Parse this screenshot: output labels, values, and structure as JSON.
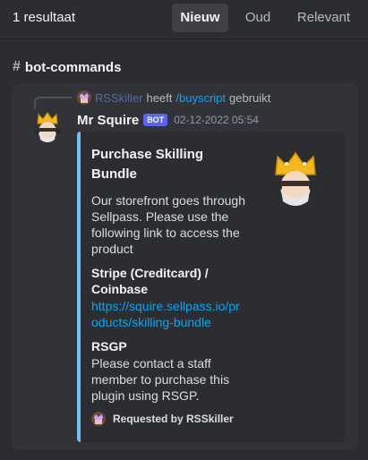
{
  "search": {
    "result_count": "1 resultaat",
    "tabs": [
      {
        "label": "Nieuw",
        "active": true
      },
      {
        "label": "Oud",
        "active": false
      },
      {
        "label": "Relevant",
        "active": false
      }
    ]
  },
  "channel": {
    "icon": "hash-icon",
    "name": "bot-commands"
  },
  "message": {
    "reply": {
      "user": "RSSkiller",
      "action": "heeft",
      "command": "/buyscript",
      "suffix": "gebruikt"
    },
    "author": "Mr Squire",
    "badge": "BOT",
    "timestamp": "02-12-2022 05:54",
    "embed": {
      "accent_color": "#6ec1f5",
      "title": "Purchase Skilling Bundle",
      "description": "Our storefront goes through Sellpass. Please use the following link to access the product",
      "fields": [
        {
          "name": "Stripe (Creditcard) / Coinbase",
          "value": "https://squire.sellpass.io/products/skilling-bundle"
        },
        {
          "name": "RSGP",
          "value": "Please contact a staff member to purchase this plugin using RSGP."
        }
      ],
      "footer": "Requested by RSSkiller"
    }
  },
  "colors": {
    "background": "#2b2d31",
    "card": "#313338",
    "link": "#00a8fc",
    "bot_badge": "#5865f2"
  }
}
